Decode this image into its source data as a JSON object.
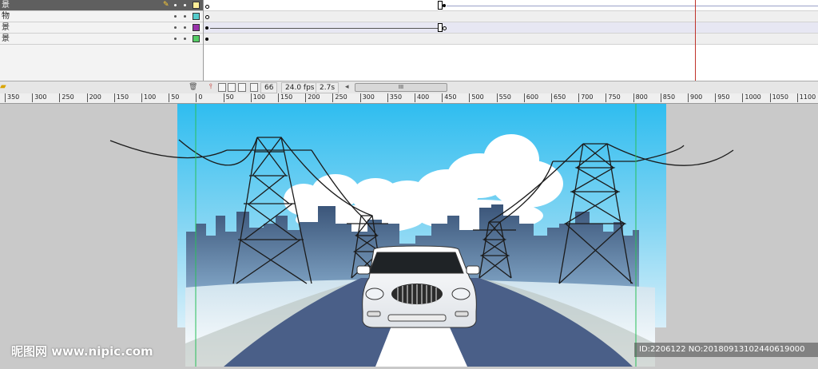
{
  "layers": [
    {
      "name": "景",
      "selected": true,
      "color": "#ffee99",
      "pencil": true
    },
    {
      "name": "物",
      "selected": false,
      "color": "#55cccc"
    },
    {
      "name": "景",
      "selected": false,
      "color": "#9933aa"
    },
    {
      "name": "景",
      "selected": false,
      "color": "#55cc66"
    }
  ],
  "status": {
    "frame": "66",
    "fps": "24.0 fps",
    "time": "2.7s",
    "scroll_grip": "III"
  },
  "ruler": [
    "350",
    "300",
    "250",
    "200",
    "150",
    "100",
    "50",
    "0",
    "50",
    "100",
    "150",
    "200",
    "250",
    "300",
    "350",
    "400",
    "450",
    "500",
    "550",
    "600",
    "650",
    "700",
    "750",
    "800",
    "850",
    "900",
    "950",
    "1000",
    "1050",
    "1100"
  ],
  "watermark": {
    "logo_text": "昵图网 www.nipic.com",
    "id_text": "ID:2206122 NO:20180913102440619000"
  },
  "colors": {
    "sky_top": "#38c2f2",
    "sky_bottom": "#c7e9f6",
    "city": "#3f5a7d",
    "road": "#4c628a",
    "stage_bg": "#c9c9c9"
  },
  "icons": [
    "folder-icon",
    "trash-icon",
    "onion-skin-icon",
    "edit-multiple-frames-icon",
    "center-frame-icon"
  ]
}
